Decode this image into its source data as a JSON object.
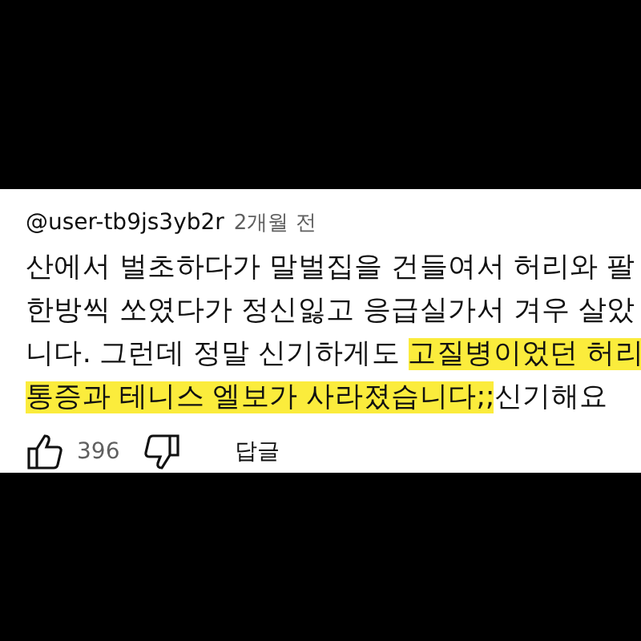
{
  "comment": {
    "author": "@user-tb9js3yb2r",
    "time": "2개월 전",
    "lines": [
      [
        {
          "text": "산에서 벌초하다가 말벌집을 건들여서 허리와 팔",
          "highlighted": false
        }
      ],
      [
        {
          "text": "한방씩 쏘였다가 정신잃고 응급실가서 겨우 살았",
          "highlighted": false
        }
      ],
      [
        {
          "text": "니다. 그런데 정말 신기하게도 ",
          "highlighted": false
        },
        {
          "text": "고질병이었던 허리",
          "highlighted": true
        }
      ],
      [
        {
          "text": "통증과 테니스 엘보가 사라졌습니다;;",
          "highlighted": true
        },
        {
          "text": "신기해요",
          "highlighted": false
        }
      ]
    ],
    "likes": "396",
    "reply": "답글"
  }
}
